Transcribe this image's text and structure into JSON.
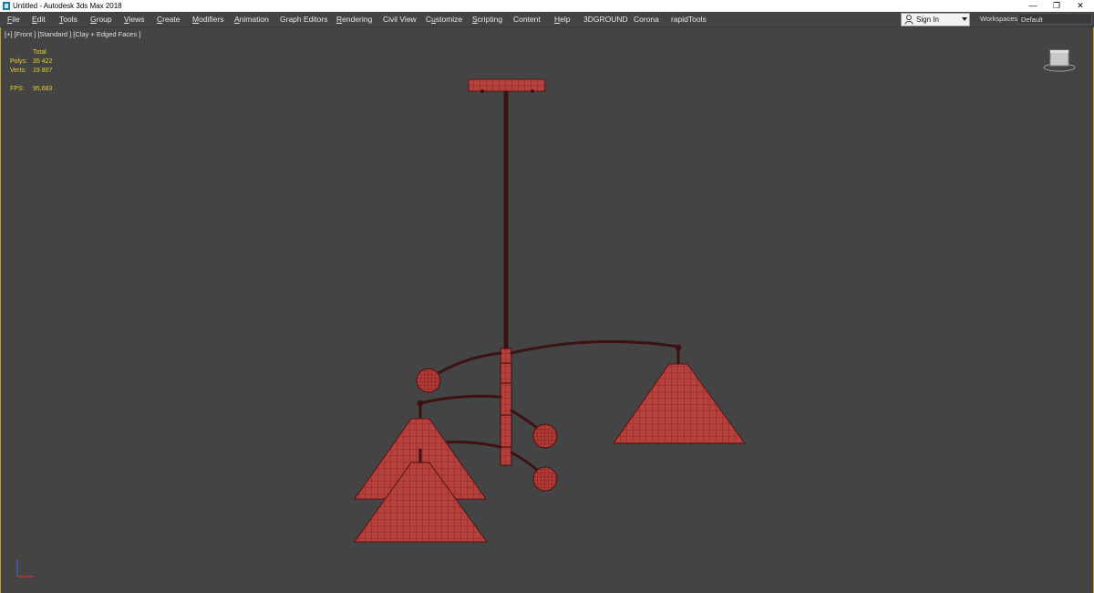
{
  "window": {
    "title": "Untitled - Autodesk 3ds Max 2018",
    "minimize": "—",
    "maximize": "❐",
    "close": "✕"
  },
  "menu": [
    {
      "label": "File",
      "underline": "F"
    },
    {
      "label": "Edit",
      "underline": "E"
    },
    {
      "label": "Tools",
      "underline": "T"
    },
    {
      "label": "Group",
      "underline": "G"
    },
    {
      "label": "Views",
      "underline": "V"
    },
    {
      "label": "Create",
      "underline": "C"
    },
    {
      "label": "Modifiers",
      "underline": "M"
    },
    {
      "label": "Animation",
      "underline": "A"
    },
    {
      "label": "Graph Editors",
      "underline": "D"
    },
    {
      "label": "Rendering",
      "underline": "R"
    },
    {
      "label": "Civil View",
      "underline": ""
    },
    {
      "label": "Customize",
      "underline": "u"
    },
    {
      "label": "Scripting",
      "underline": "S"
    },
    {
      "label": "Content",
      "underline": ""
    },
    {
      "label": "Help",
      "underline": "H"
    },
    {
      "label": "3DGROUND",
      "underline": ""
    },
    {
      "label": "Corona",
      "underline": ""
    },
    {
      "label": "rapidTools",
      "underline": ""
    }
  ],
  "account": {
    "signin_label": "Sign In",
    "icon": "person-icon"
  },
  "workspace": {
    "label": "Workspaces:",
    "value": "Default"
  },
  "viewport": {
    "label": "[+] [Front ] [Standard ] [Clay + Edged Faces ]",
    "stats_header": "Total",
    "stats": [
      {
        "key": "Polys:",
        "value": "35 422"
      },
      {
        "key": "Verts:",
        "value": "19 807"
      }
    ],
    "fps_key": "FPS:",
    "fps_value": "95,683"
  },
  "colors": {
    "viewport_bg": "#444444",
    "model": "#b5403c",
    "wire": "#6a1818",
    "stats_text": "#e6d02a",
    "active_border": "#c8a020"
  }
}
